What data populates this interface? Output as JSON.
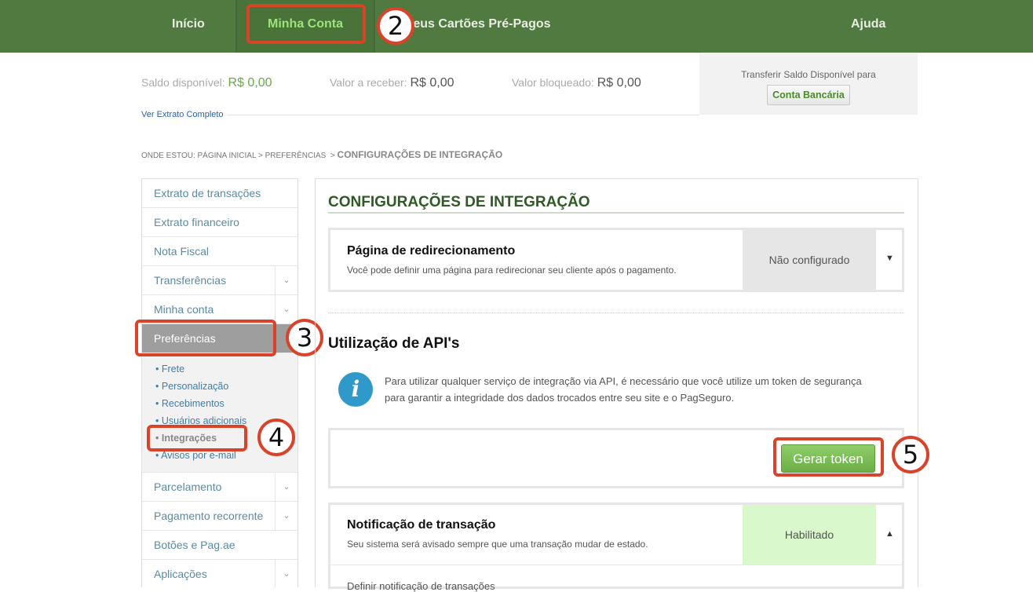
{
  "nav": {
    "inicio": "Início",
    "minha_conta": "Minha Conta",
    "cartoes": "Meus Cartões Pré-Pagos",
    "ajuda": "Ajuda"
  },
  "balances": {
    "disponivel_label": "Saldo disponível:",
    "disponivel_value": "R$ 0,00",
    "receber_label": "Valor a receber:",
    "receber_value": "R$ 0,00",
    "bloqueado_label": "Valor bloqueado:",
    "bloqueado_value": "R$ 0,00",
    "extrato_link": "Ver Extrato Completo",
    "transfer_label": "Transferir Saldo Disponível para",
    "transfer_button": "Conta Bancária"
  },
  "breadcrumb": {
    "prefix": "ONDE ESTOU:",
    "home": "PÁGINA INICIAL",
    "pref": "PREFERÊNCIAS",
    "current": "CONFIGURAÇÕES DE INTEGRAÇÃO"
  },
  "sidebar": {
    "items": [
      "Extrato de transações",
      "Extrato financeiro",
      "Nota Fiscal",
      "Transferências",
      "Minha conta",
      "Preferências",
      "Parcelamento",
      "Pagamento recorrente",
      "Botões e Pag.ae",
      "Aplicações"
    ],
    "sub": [
      "Frete",
      "Personalização",
      "Recebimentos",
      "Usuários adicionais",
      "Integrações",
      "Avisos por e-mail"
    ]
  },
  "main": {
    "title": "CONFIGURAÇÕES DE INTEGRAÇÃO",
    "redirect": {
      "title": "Página de redirecionamento",
      "desc": "Você pode definir uma página para redirecionar seu cliente após o pagamento.",
      "status": "Não configurado"
    },
    "api": {
      "title": "Utilização de API's",
      "info_line1": "Para utilizar qualquer serviço de integração via API, é necessário que você utilize um token de segurança",
      "info_line2": "para garantir a integridade dos dados trocados entre seu site e o PagSeguro.",
      "button": "Gerar token"
    },
    "notif": {
      "title": "Notificação de transação",
      "desc": "Seu sistema será avisado sempre que uma transação mudar de estado.",
      "status": "Habilitado",
      "next_line": "Definir notificação de transações"
    }
  },
  "annotations": [
    "2",
    "3",
    "4",
    "5"
  ],
  "colors": {
    "nav_bg": "#507a40",
    "accent_green": "#6aa84f",
    "highlight_red": "#d8432a",
    "link_blue": "#3d7fab"
  }
}
